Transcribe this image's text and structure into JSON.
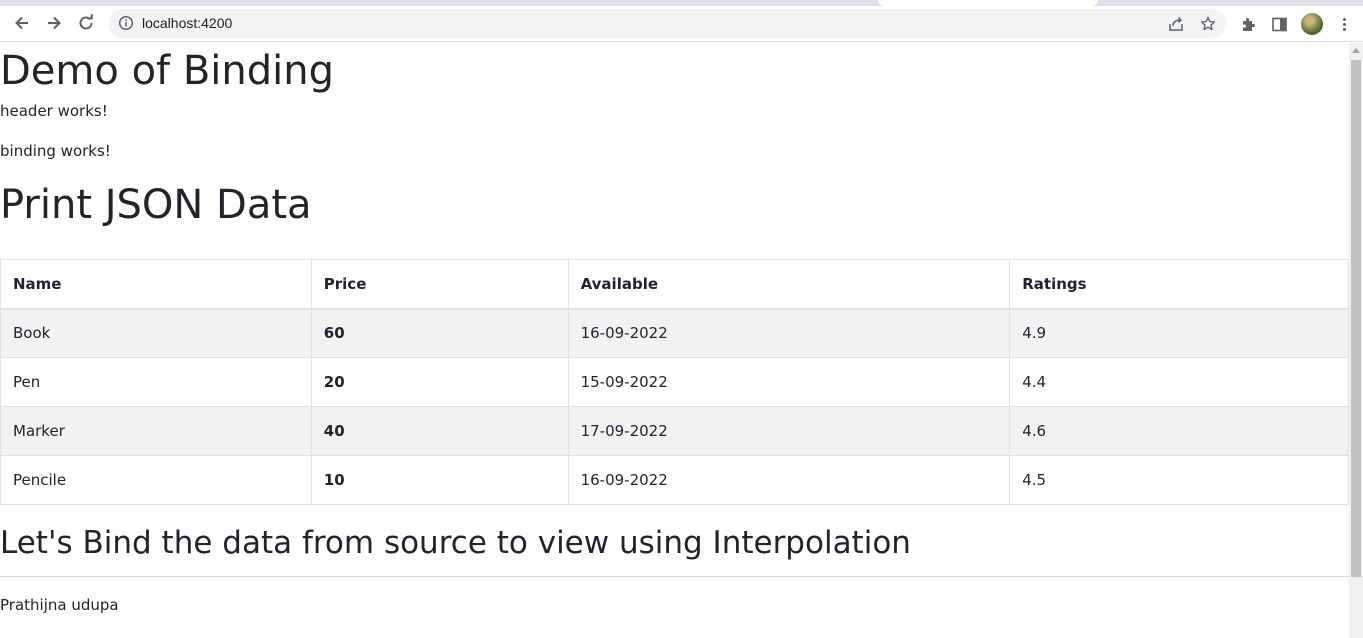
{
  "browser": {
    "url": "localhost:4200"
  },
  "page": {
    "title": "Demo of Binding",
    "header_text": "header works!",
    "binding_text": "binding works!",
    "section_title": "Print JSON Data",
    "table": {
      "columns": [
        "Name",
        "Price",
        "Available",
        "Ratings"
      ],
      "rows": [
        {
          "name": "Book",
          "price": "60",
          "available": "16-09-2022",
          "rating": "4.9"
        },
        {
          "name": "Pen",
          "price": "20",
          "available": "15-09-2022",
          "rating": "4.4"
        },
        {
          "name": "Marker",
          "price": "40",
          "available": "17-09-2022",
          "rating": "4.6"
        },
        {
          "name": "Pencile",
          "price": "10",
          "available": "16-09-2022",
          "rating": "4.5"
        }
      ]
    },
    "interpolation_title": "Let's Bind the data from source to view using Interpolation",
    "author": "Prathijna udupa"
  }
}
